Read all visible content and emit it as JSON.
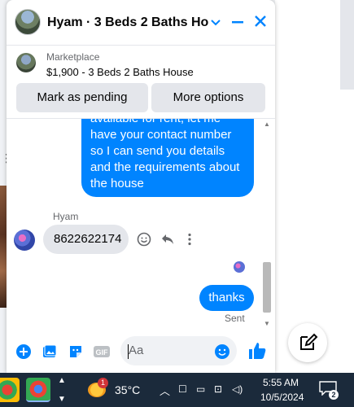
{
  "chat": {
    "title": "Hyam · 3 Beds 2 Baths Ho…",
    "listing": {
      "category": "Marketplace",
      "summary": "$1,900 - 3 Beds 2 Baths House"
    },
    "buttons": {
      "mark_pending": "Mark as pending",
      "more_options": "More options"
    },
    "messages": {
      "outgoing_partial_lines": [
        "available for rent, let me",
        "have your contact number",
        "so I can send you details",
        "and the requirements about",
        "the house"
      ],
      "sender_name": "Hyam",
      "incoming_text": "8622622174",
      "outgoing_last": "thanks",
      "status": "Sent"
    },
    "composer": {
      "placeholder": "Aa",
      "gif_label": "GIF"
    }
  },
  "taskbar": {
    "weather_temp": "35°C",
    "weather_badge": "1",
    "time": "5:55 AM",
    "date": "10/5/2024",
    "notification_count": "2"
  },
  "colors": {
    "accent": "#0084ff",
    "bubble_incoming": "#e4e6eb",
    "taskbar": "#1b2a3b"
  }
}
